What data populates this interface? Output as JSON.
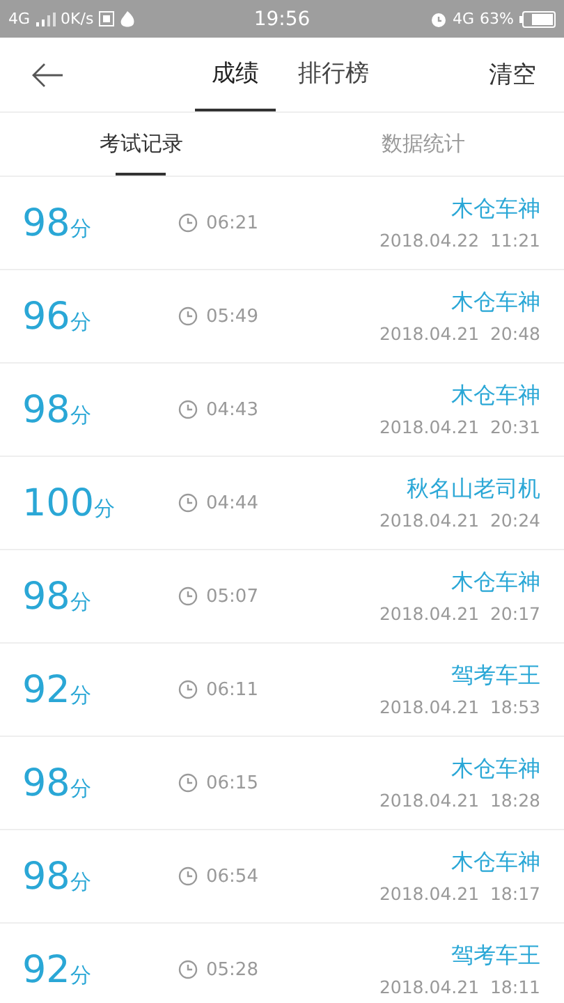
{
  "status_bar": {
    "network": "4G",
    "speed": "0K/s",
    "time": "19:56",
    "network_right": "4G",
    "battery": "63%"
  },
  "header": {
    "tabs": [
      {
        "label": "成绩",
        "selected": true
      },
      {
        "label": "排行榜",
        "selected": false
      }
    ],
    "action": "清空"
  },
  "sub_tabs": [
    {
      "label": "考试记录",
      "selected": true
    },
    {
      "label": "数据统计",
      "selected": false
    }
  ],
  "records": [
    {
      "score": "98",
      "unit": "分",
      "duration": "06:21",
      "name": "木仓车神",
      "date": "2018.04.22",
      "time": "11:21"
    },
    {
      "score": "96",
      "unit": "分",
      "duration": "05:49",
      "name": "木仓车神",
      "date": "2018.04.21",
      "time": "20:48"
    },
    {
      "score": "98",
      "unit": "分",
      "duration": "04:43",
      "name": "木仓车神",
      "date": "2018.04.21",
      "time": "20:31"
    },
    {
      "score": "100",
      "unit": "分",
      "duration": "04:44",
      "name": "秋名山老司机",
      "date": "2018.04.21",
      "time": "20:24"
    },
    {
      "score": "98",
      "unit": "分",
      "duration": "05:07",
      "name": "木仓车神",
      "date": "2018.04.21",
      "time": "20:17"
    },
    {
      "score": "92",
      "unit": "分",
      "duration": "06:11",
      "name": "驾考车王",
      "date": "2018.04.21",
      "time": "18:53"
    },
    {
      "score": "98",
      "unit": "分",
      "duration": "06:15",
      "name": "木仓车神",
      "date": "2018.04.21",
      "time": "18:28"
    },
    {
      "score": "98",
      "unit": "分",
      "duration": "06:54",
      "name": "木仓车神",
      "date": "2018.04.21",
      "time": "18:17"
    },
    {
      "score": "92",
      "unit": "分",
      "duration": "05:28",
      "name": "驾考车王",
      "date": "2018.04.21",
      "time": "18:11"
    }
  ]
}
